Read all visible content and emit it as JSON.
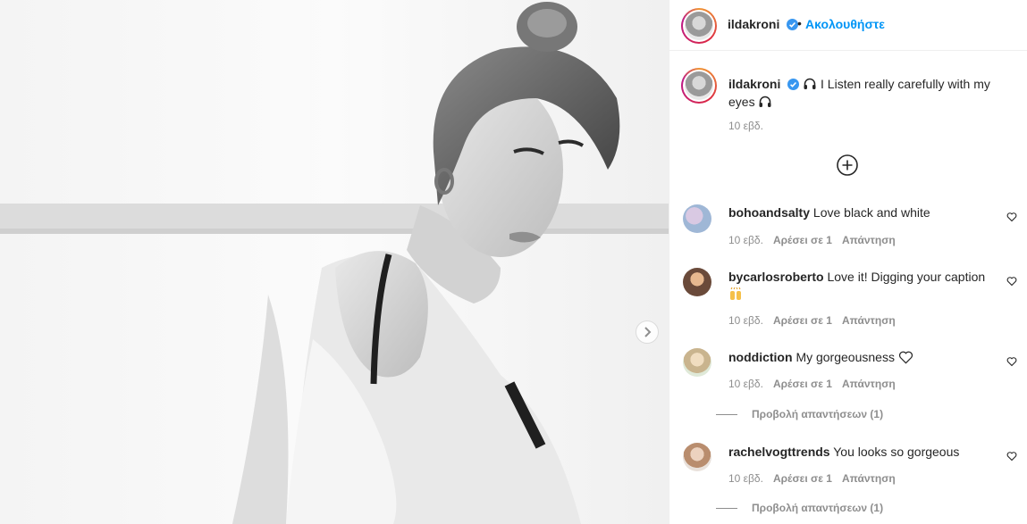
{
  "post": {
    "author": "ildakroni",
    "follow_label": "Ακολουθήστε",
    "separator": "•",
    "caption_text": "I Listen really carefully with my eyes",
    "caption_time": "10 εβδ."
  },
  "comments": [
    {
      "user": "bohoandsalty",
      "text": "Love black and white",
      "time": "10 εβδ.",
      "likes": "Αρέσει σε 1",
      "reply": "Απάντηση"
    },
    {
      "user": "bycarlosroberto",
      "text": "Love it! Digging your caption",
      "time": "10 εβδ.",
      "likes": "Αρέσει σε 1",
      "reply": "Απάντηση"
    },
    {
      "user": "noddiction",
      "text": "My gorgeousness",
      "time": "10 εβδ.",
      "likes": "Αρέσει σε 1",
      "reply": "Απάντηση",
      "view_replies": "Προβολή απαντήσεων (1)"
    },
    {
      "user": "rachelvogttrends",
      "text": "You looks so gorgeous",
      "time": "10 εβδ.",
      "likes": "Αρέσει σε 1",
      "reply": "Απάντηση",
      "view_replies": "Προβολή απαντήσεων (1)"
    }
  ],
  "icons": {
    "verified": "verified-badge-icon",
    "headphones": "headphones-icon",
    "load_more": "plus-circle-icon",
    "like": "heart-outline-icon",
    "next": "chevron-right-icon"
  },
  "colors": {
    "accent": "#0095f6",
    "muted": "#8e8e8e",
    "text": "#262626"
  }
}
